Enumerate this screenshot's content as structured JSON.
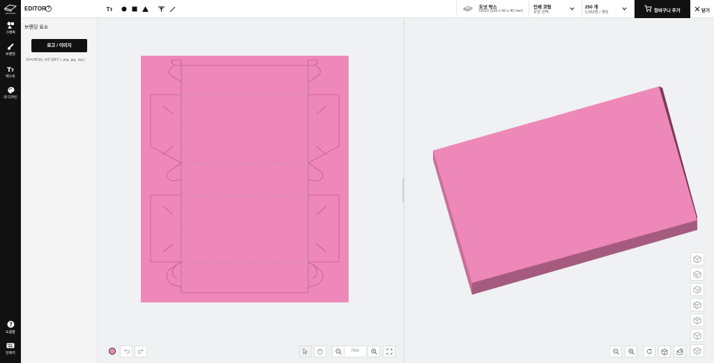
{
  "rail": {
    "logo_text": "panosline",
    "items": [
      {
        "label": "그래픽",
        "icon": "shapes-icon"
      },
      {
        "label": "브랜딩",
        "icon": "brush-icon"
      },
      {
        "label": "텍스트",
        "icon": "text-icon"
      },
      {
        "label": "내 디자인",
        "icon": "palette-icon"
      }
    ],
    "bottom": [
      {
        "label": "도움말",
        "icon": "help-icon"
      },
      {
        "label": "단축키",
        "icon": "keyboard-icon"
      }
    ]
  },
  "topbar": {
    "editor_label": "EDITOR",
    "help": "?",
    "tools": [
      "text-tool-icon",
      "circle-tool-icon",
      "square-tool-icon",
      "triangle-tool-icon",
      "align-top-icon",
      "line-tool-icon"
    ],
    "text_tool_label": "Tт",
    "product": {
      "name": "도넛 박스",
      "spec": "DN10 (165 x 90 x 40 mm)"
    },
    "coating": {
      "name": "인쇄 코팅",
      "sub": "무광 선택"
    },
    "quantity": {
      "value": "250 개",
      "sub": "1,552원 / 개당"
    },
    "cart_label": "장바구니 추가",
    "close_label": "닫기"
  },
  "panel": {
    "title": "브랜딩 요소",
    "button_label": "로고 / 이미지",
    "hint": "내 PC에 있는 사진 업로드 ( .png, .jpg, .svg )"
  },
  "canvas2d": {
    "zoom": "76%",
    "box_color": "#ee88b8"
  },
  "colors": {
    "accent": "#111111",
    "box_pink": "#ee88b8",
    "box_side": "#9c5877"
  }
}
